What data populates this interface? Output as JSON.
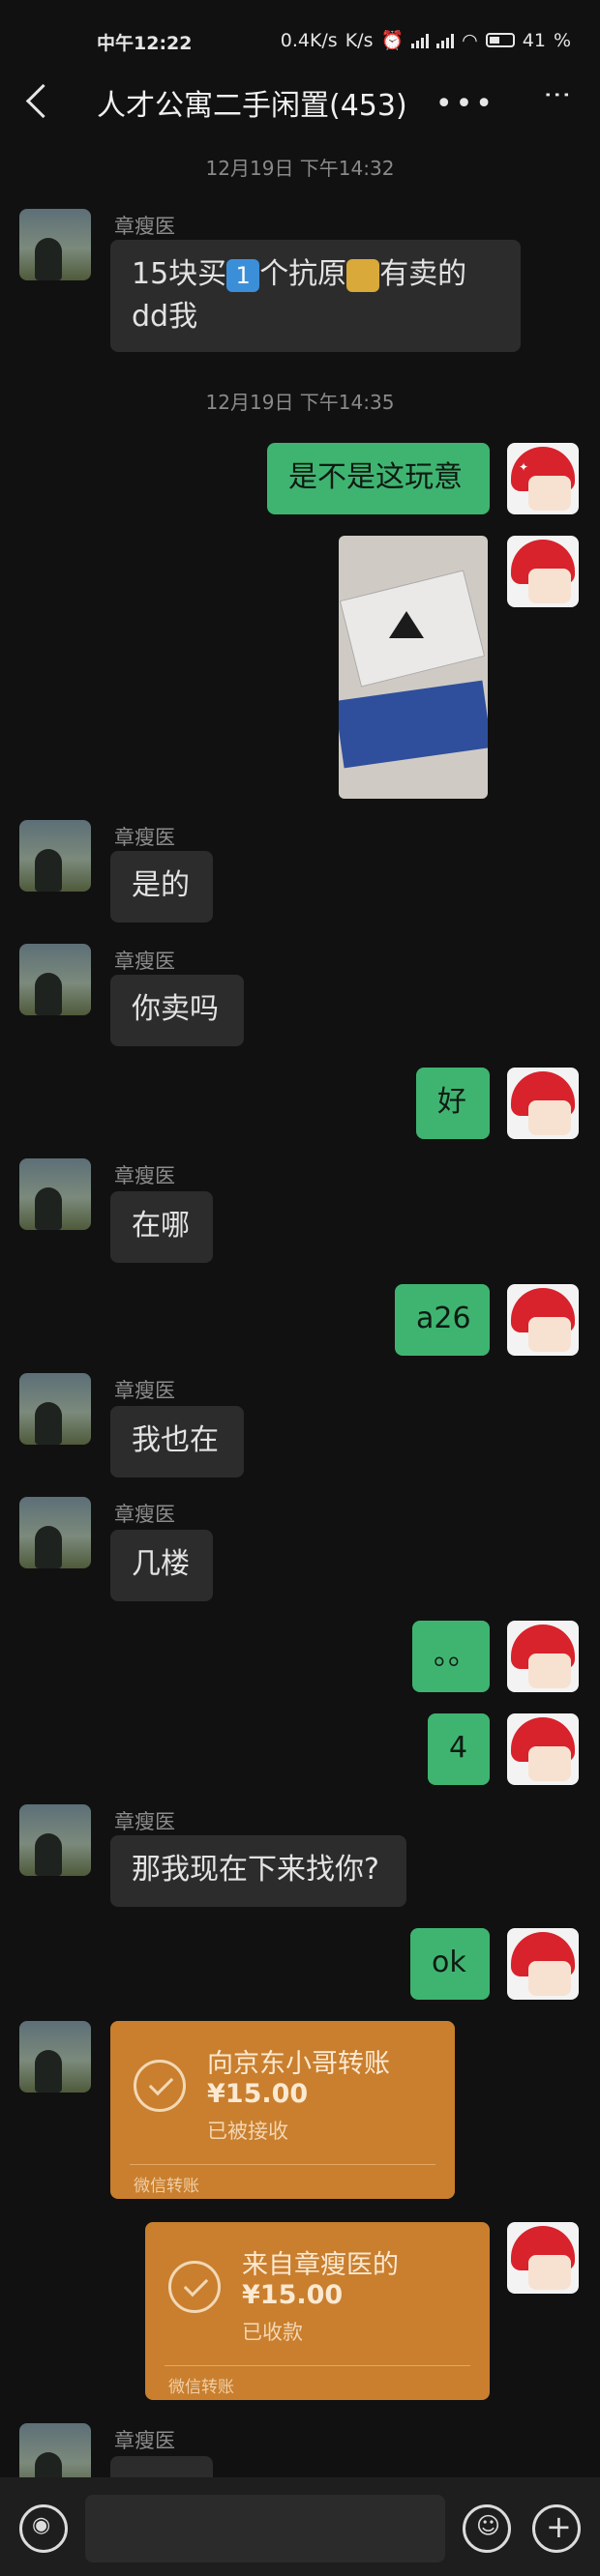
{
  "status_bar": {
    "time": "中午12:22",
    "net": "0.4K/s",
    "battery": "41"
  },
  "header": {
    "title": "人才公寓二手闲置(453)",
    "more": "•••",
    "menu": "⋮"
  },
  "timestamps": [
    "12月19日 下午14:32",
    "12月19日 下午14:35"
  ],
  "contact_name": "章瘦医",
  "messages": {
    "m1_line1": "15块买",
    "m1_num": "1",
    "m1_mid": "个抗原",
    "m1_end": "有卖的",
    "m1_line2": "dd我",
    "m2": "是不是这玩意",
    "m3": "是的",
    "m4": "你卖吗",
    "m5": "好",
    "m6": "在哪",
    "m7": "a26",
    "m8": "我也在",
    "m9": "几楼",
    "m10": "。。",
    "m11": "4",
    "m12": "那我现在下来找你?",
    "m13": "ok"
  },
  "transfer1": {
    "title": "向京东小哥转账",
    "amount": "¥15.00",
    "status": "已被接收",
    "footer": "微信转账"
  },
  "transfer2": {
    "title": "来自章瘦医的",
    "amount": "¥15.00",
    "status": "已收款",
    "footer": "微信转账"
  },
  "colors": {
    "bg": "#111111",
    "bubble_self": "#3fb471",
    "bubble_other": "#2c2c2c",
    "transfer": "#c97f2e"
  }
}
